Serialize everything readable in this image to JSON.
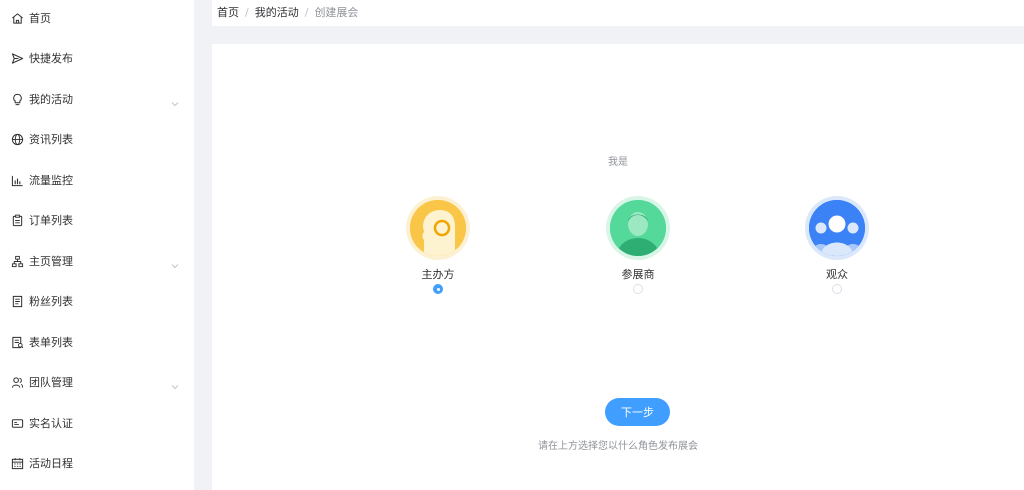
{
  "sidebar": {
    "items": [
      {
        "label": "首页",
        "icon": "home-icon",
        "has_arrow": false
      },
      {
        "label": "快捷发布",
        "icon": "send-icon",
        "has_arrow": false
      },
      {
        "label": "我的活动",
        "icon": "bulb-icon",
        "has_arrow": true
      },
      {
        "label": "资讯列表",
        "icon": "globe-icon",
        "has_arrow": false
      },
      {
        "label": "流量监控",
        "icon": "chart-icon",
        "has_arrow": false
      },
      {
        "label": "订单列表",
        "icon": "clipboard-icon",
        "has_arrow": false
      },
      {
        "label": "主页管理",
        "icon": "sitemap-icon",
        "has_arrow": true
      },
      {
        "label": "粉丝列表",
        "icon": "document-icon",
        "has_arrow": false
      },
      {
        "label": "表单列表",
        "icon": "form-icon",
        "has_arrow": false
      },
      {
        "label": "团队管理",
        "icon": "team-icon",
        "has_arrow": true
      },
      {
        "label": "实名认证",
        "icon": "id-card-icon",
        "has_arrow": false
      },
      {
        "label": "活动日程",
        "icon": "calendar-icon",
        "has_arrow": false
      }
    ]
  },
  "breadcrumb": {
    "home": "首页",
    "parent": "我的活动",
    "current": "创建展会",
    "separator": "/"
  },
  "main": {
    "prompt": "我是",
    "roles": [
      {
        "label": "主办方",
        "checked": true,
        "color": "#f9c647"
      },
      {
        "label": "参展商",
        "checked": false,
        "color": "#3ecf8e"
      },
      {
        "label": "观众",
        "checked": false,
        "color": "#3b82f6"
      }
    ],
    "next_label": "下一步",
    "hint": "请在上方选择您以什么角色发布展会"
  },
  "colors": {
    "primary": "#409eff",
    "background": "#f0f2f5"
  }
}
